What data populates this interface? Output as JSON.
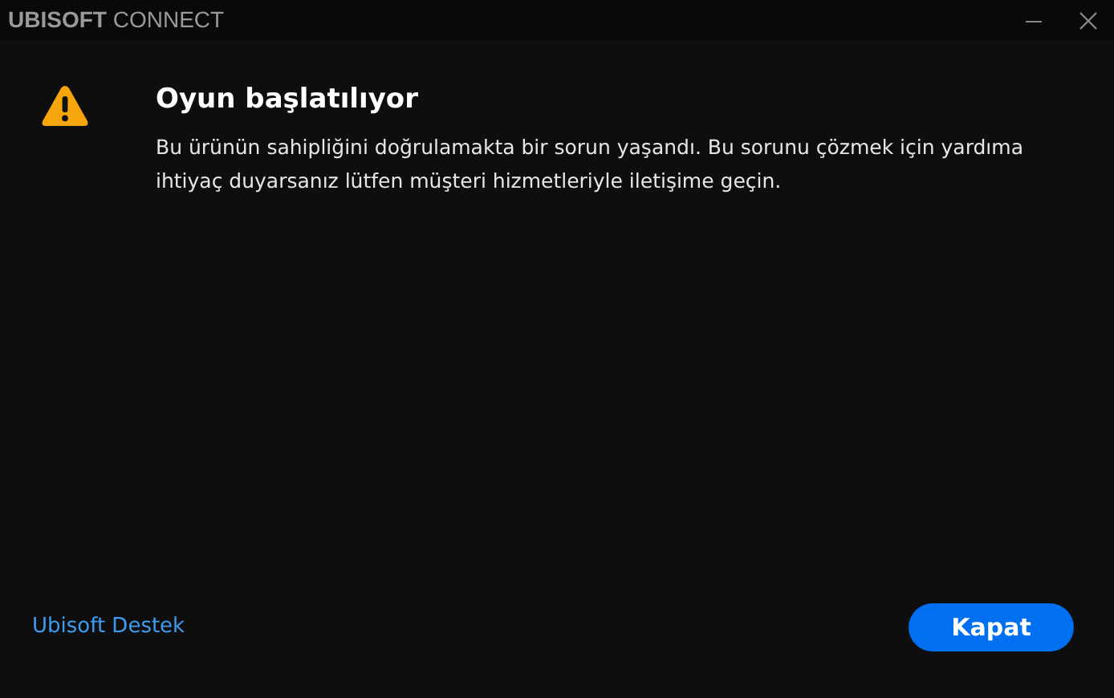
{
  "window": {
    "title": "**UBISOFT** CONNECT"
  },
  "dialog": {
    "title": "Oyun başlatılıyor",
    "message": "Bu ürünün sahipliğini doğrulamakta bir sorun yaşandı. Bu sorunu çözmek için yardıma ihtiyaç duyarsanız lütfen müşteri hizmetleriyle iletişime geçin."
  },
  "footer": {
    "link": "Ubisoft Destek",
    "button": "Kapat"
  }
}
